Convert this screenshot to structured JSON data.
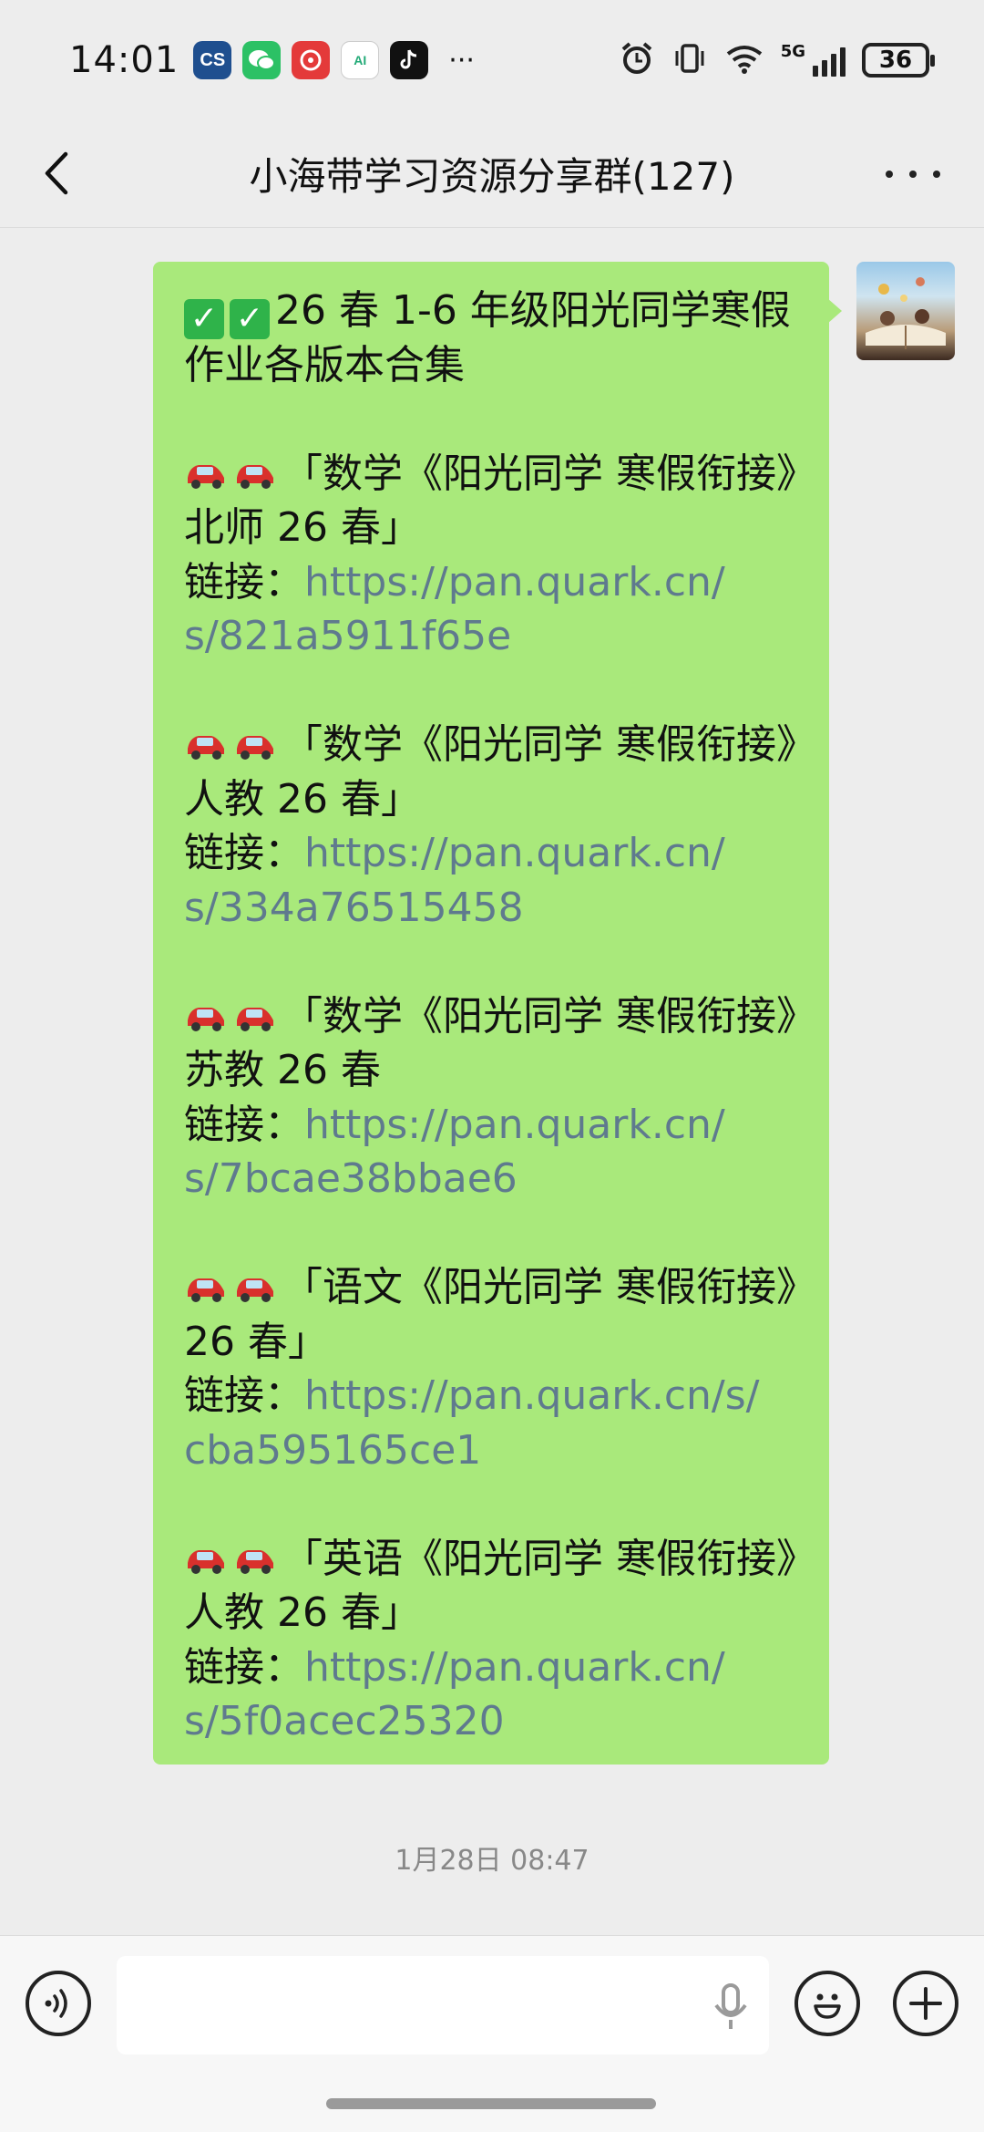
{
  "status_bar": {
    "time": "14:01",
    "app_icons": [
      {
        "name": "camscanner-icon",
        "text": "CS",
        "color": "#1f4f8f"
      },
      {
        "name": "wechat-icon",
        "text": "",
        "color": "#2cc165"
      },
      {
        "name": "taobao-icon",
        "text": "",
        "color": "#e43a3a"
      },
      {
        "name": "ai-app-icon",
        "text": "AI",
        "color": "#ffffff"
      },
      {
        "name": "douyin-icon",
        "text": "",
        "color": "#111111"
      }
    ],
    "more": "···",
    "network": "5G",
    "battery": "36"
  },
  "header": {
    "title": "小海带学习资源分享群(127)"
  },
  "message": {
    "heading_line1": "26 春 1-6 年级阳光同学寒假",
    "heading_line2": "作业各版本合集",
    "link_label": "链接：",
    "items": [
      {
        "title1": "「数学《阳光同学 寒假衔接》",
        "title2": "北师 26 春」",
        "url1": "https://pan.quark.cn/",
        "url2": "s/821a5911f65e"
      },
      {
        "title1": "「数学《阳光同学 寒假衔接》",
        "title2": "人教 26 春」",
        "url1": "https://pan.quark.cn/",
        "url2": "s/334a76515458"
      },
      {
        "title1": "「数学《阳光同学 寒假衔接》",
        "title2": "苏教 26 春",
        "url1": "https://pan.quark.cn/",
        "url2": "s/7bcae38bbae6"
      },
      {
        "title1": "「语文《阳光同学 寒假衔接》",
        "title2": "26 春」",
        "url1": "https://pan.quark.cn/s/",
        "url2": "cba595165ce1"
      },
      {
        "title1": "「英语《阳光同学 寒假衔接》",
        "title2": "人教 26 春」",
        "url1": "https://pan.quark.cn/",
        "url2": "s/5f0acec25320"
      }
    ]
  },
  "timestamp": "1月28日 08:47",
  "colors": {
    "bubble": "#a9e97b",
    "link": "#5f7a8e",
    "background": "#ededed"
  }
}
